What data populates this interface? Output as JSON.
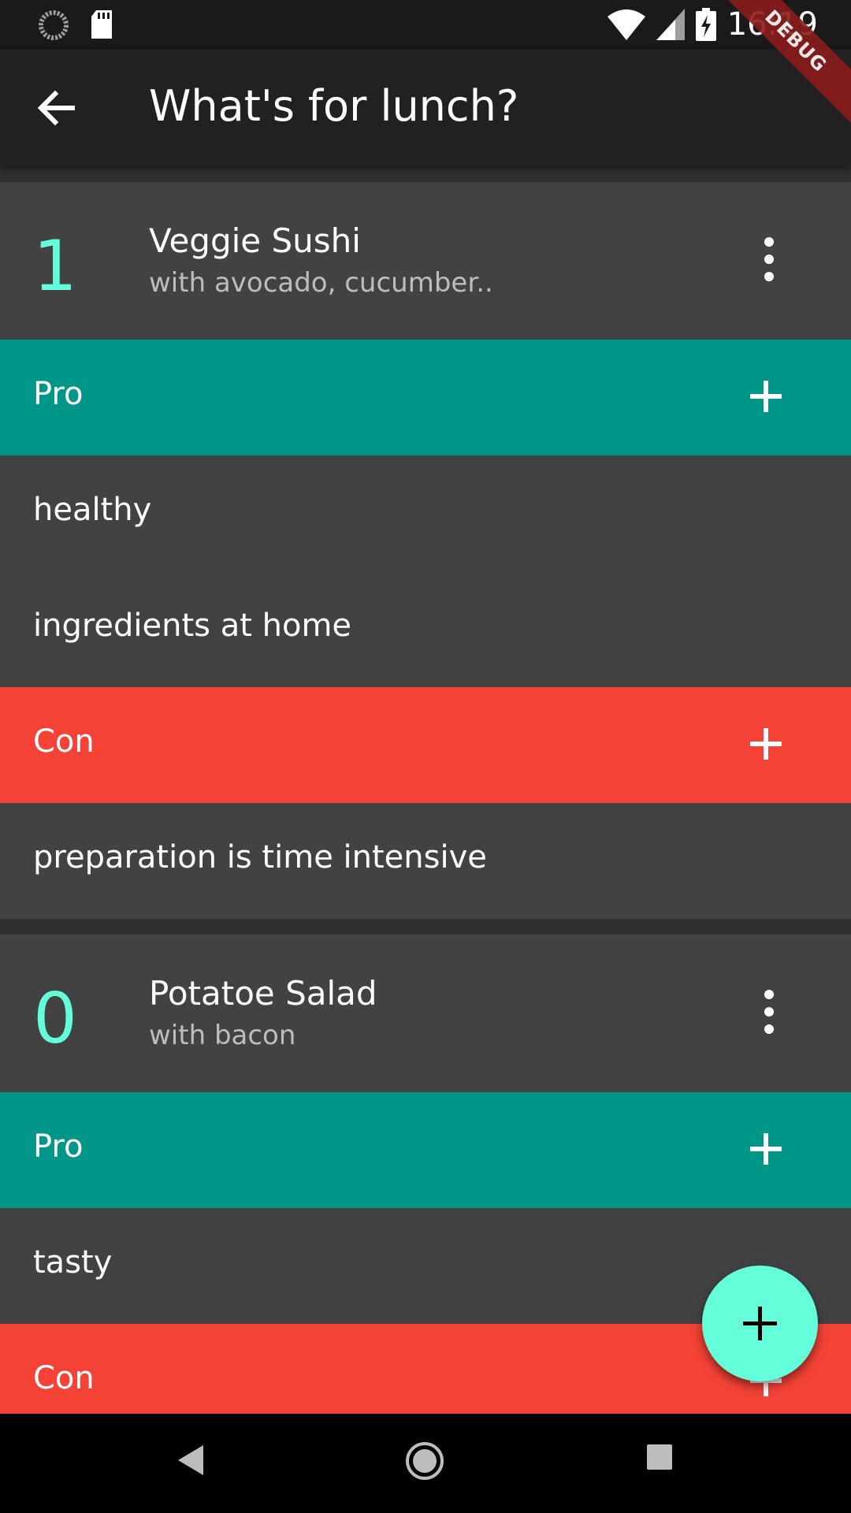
{
  "status_bar": {
    "time": "16:19"
  },
  "debug_banner": "DEBUG",
  "app_bar": {
    "title": "What's for lunch?"
  },
  "cards": [
    {
      "score": "1",
      "name": "Veggie Sushi",
      "description": "with avocado, cucumber..",
      "pro_label": "Pro",
      "pros": [
        "healthy",
        "ingredients at home"
      ],
      "con_label": "Con",
      "cons": [
        "preparation is time intensive"
      ]
    },
    {
      "score": "0",
      "name": "Potatoe Salad",
      "description": "with bacon",
      "pro_label": "Pro",
      "pros": [
        "tasty"
      ],
      "con_label": "Con",
      "cons": []
    }
  ],
  "colors": {
    "accent": "#64ffda",
    "pro": "#009688",
    "con": "#f44336",
    "card": "#424242",
    "app_bar": "#212121"
  },
  "icons": {
    "back": "arrow-back-icon",
    "menu": "more-vert-icon",
    "add": "plus-icon",
    "fab": "plus-icon",
    "nav_back": "triangle-back-icon",
    "nav_home": "circle-home-icon",
    "nav_recents": "square-recents-icon"
  }
}
